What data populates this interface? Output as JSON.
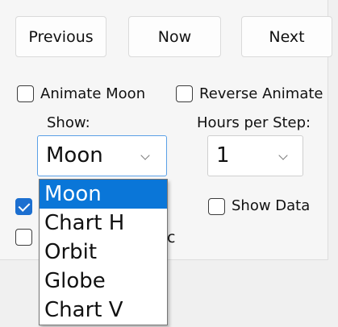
{
  "buttons": {
    "previous": "Previous",
    "now": "Now",
    "next": "Next"
  },
  "checkboxes": {
    "animate_moon": {
      "label": "Animate Moon",
      "checked": false
    },
    "reverse_animate": {
      "label": "Reverse Animate",
      "checked": false
    },
    "show_data": {
      "label": "Show Data",
      "checked": false
    },
    "left_checked": {
      "checked": true
    },
    "left_unchecked": {
      "label_tail": "c",
      "checked": false
    }
  },
  "show": {
    "label": "Show:",
    "value": "Moon",
    "options": [
      "Moon",
      "Chart H",
      "Orbit",
      "Globe",
      "Chart V"
    ],
    "selected_index": 0
  },
  "hours_per_step": {
    "label": "Hours per Step:",
    "value": "1"
  },
  "colors": {
    "accent": "#0a76d8",
    "checked": "#1c6fd0"
  }
}
